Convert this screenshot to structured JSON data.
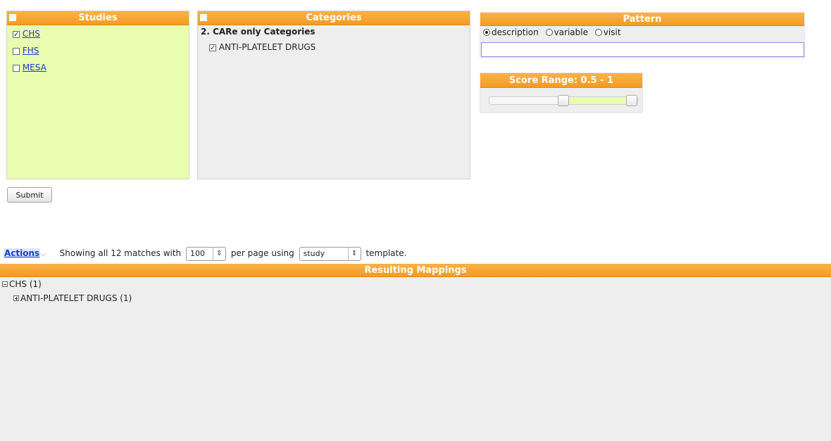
{
  "studies": {
    "title": "Studies",
    "items": [
      {
        "label": "CHS",
        "checked": true
      },
      {
        "label": "FHS",
        "checked": false
      },
      {
        "label": "MESA",
        "checked": false
      }
    ]
  },
  "categories": {
    "title": "Categories",
    "group_title": "2. CARe only Categories",
    "items": [
      {
        "label": "ANTI-PLATELET DRUGS",
        "checked": true
      }
    ]
  },
  "pattern": {
    "title": "Pattern",
    "options": [
      {
        "label": "description",
        "selected": true
      },
      {
        "label": "variable",
        "selected": false
      },
      {
        "label": "visit",
        "selected": false
      }
    ],
    "input_value": ""
  },
  "score_range": {
    "title": "Score Range: 0.5 - 1",
    "min": 0,
    "max": 1,
    "low": 0.5,
    "high": 1
  },
  "submit_label": "Submit",
  "actions_bar": {
    "actions_label": "Actions",
    "showing_text": "Showing all 12 matches",
    "with_text": "with",
    "per_page_value": "100",
    "per_page_text": "per page using",
    "template_value": "study",
    "template_text": "template."
  },
  "results": {
    "title": "Resulting Mappings",
    "tree": [
      {
        "label": "CHS (1)",
        "expanded": true,
        "children": [
          {
            "label": "ANTI-PLATELET DRUGS (1)",
            "expanded": false
          }
        ]
      }
    ]
  },
  "colors": {
    "header_orange": "#f49b22",
    "studies_bg": "#e8fdb0",
    "panel_bg": "#eeeeee",
    "link_blue": "#1a3cc8"
  }
}
